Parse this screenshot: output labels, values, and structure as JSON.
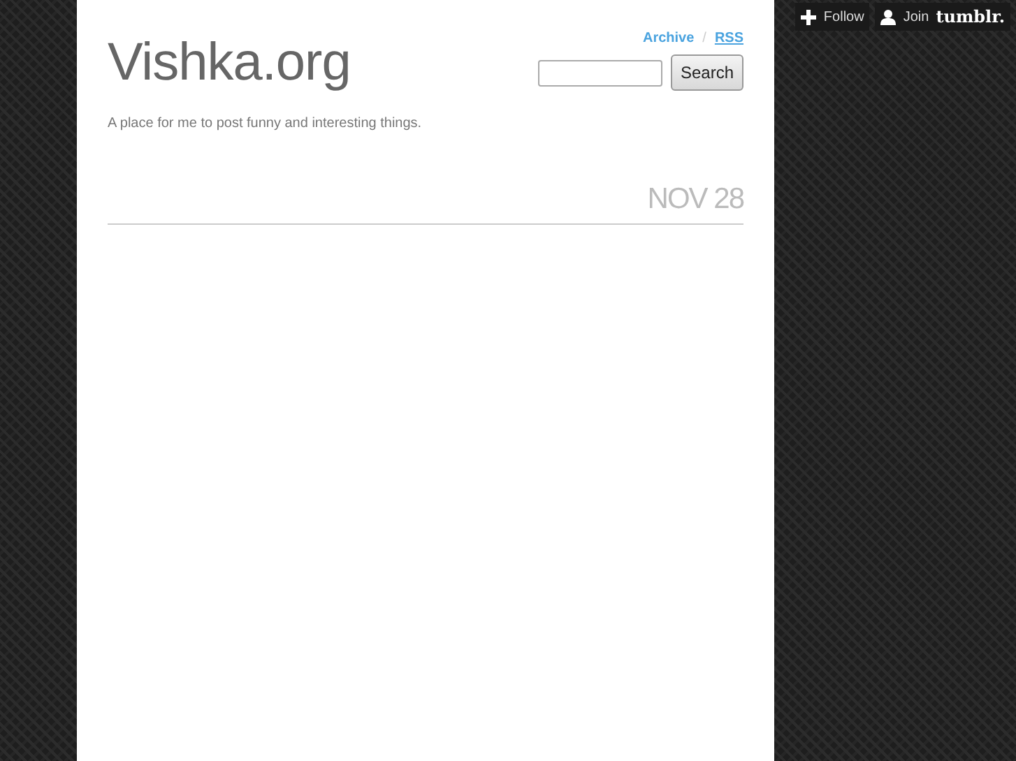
{
  "blog": {
    "title": "Vishka.org",
    "description": "A place for me to post funny and interesting things."
  },
  "nav": {
    "links": [
      "Archive",
      "RSS"
    ],
    "separator": "/"
  },
  "search": {
    "button": "Search"
  },
  "post": {
    "date": "NOV 28"
  },
  "tumblr_controls": {
    "follow": "Follow",
    "join": "Join",
    "brand": "tumblr."
  }
}
